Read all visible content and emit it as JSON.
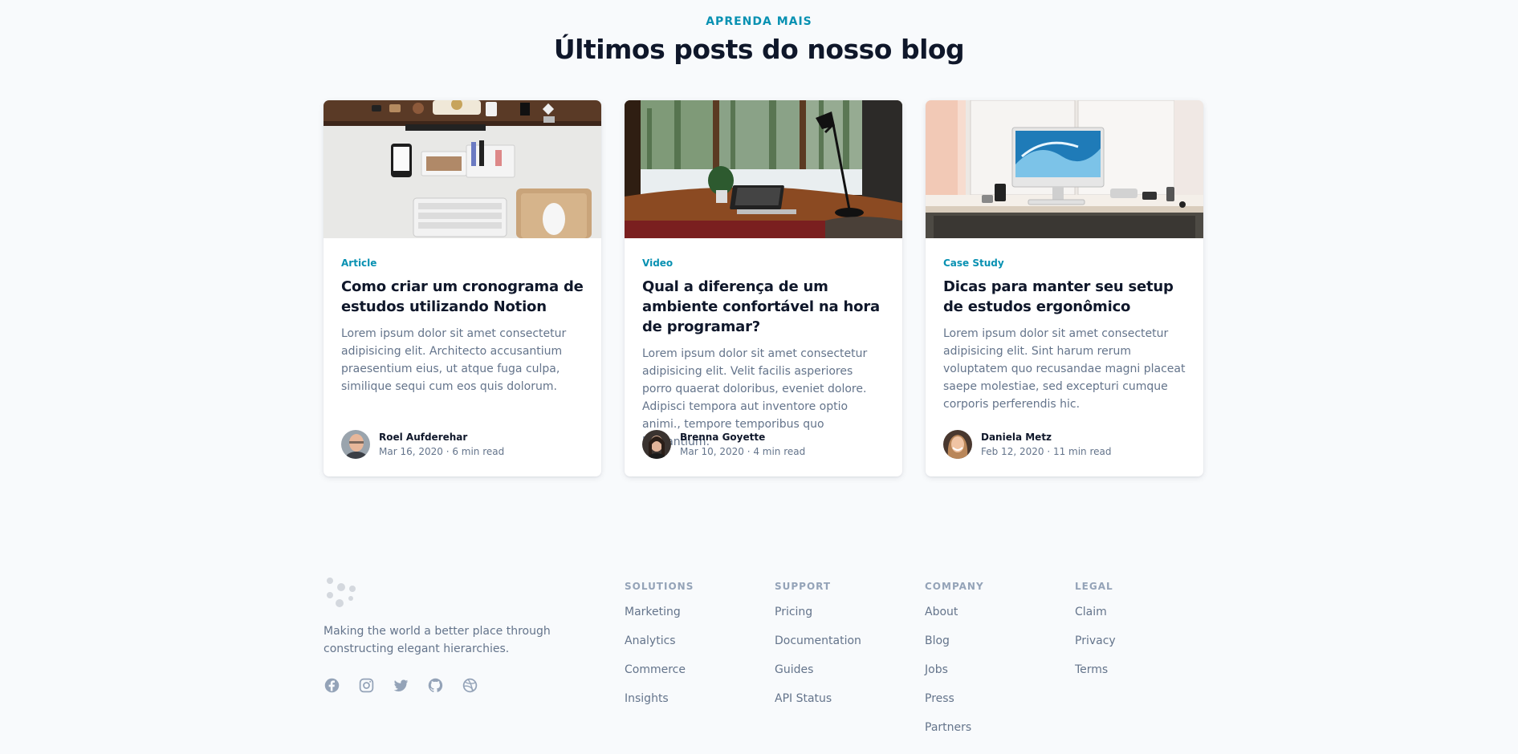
{
  "blog": {
    "eyebrow": "APRENDA MAIS",
    "title": "Últimos posts do nosso blog"
  },
  "posts": [
    {
      "category": "Article",
      "title": "Como criar um cronograma de estudos utilizando Notion",
      "excerpt": "Lorem ipsum dolor sit amet consectetur adipisicing elit. Architecto accusantium praesentium eius, ut atque fuga culpa, similique sequi cum eos quis dolorum.",
      "author": "Roel Aufderehar",
      "meta": "Mar 16, 2020 · 6 min read"
    },
    {
      "category": "Video",
      "title": "Qual a diferença de um ambiente confortável na hora de programar?",
      "excerpt": "Lorem ipsum dolor sit amet consectetur adipisicing elit. Velit facilis asperiores porro quaerat doloribus, eveniet dolore. Adipisci tempora aut inventore optio animi., tempore temporibus quo laudantium.",
      "author": "Brenna Goyette",
      "meta": "Mar 10, 2020 · 4 min read"
    },
    {
      "category": "Case Study",
      "title": "Dicas para manter seu setup de estudos ergonômico",
      "excerpt": "Lorem ipsum dolor sit amet consectetur adipisicing elit. Sint harum rerum voluptatem quo recusandae magni placeat saepe molestiae, sed excepturi cumque corporis perferendis hic.",
      "author": "Daniela Metz",
      "meta": "Feb 12, 2020 · 11 min read"
    }
  ],
  "footer": {
    "tagline": "Making the world a better place through constructing elegant hierarchies.",
    "social_icons": [
      "facebook-icon",
      "instagram-icon",
      "twitter-icon",
      "github-icon",
      "dribbble-icon"
    ],
    "columns": [
      {
        "title": "Solutions",
        "links": [
          "Marketing",
          "Analytics",
          "Commerce",
          "Insights"
        ]
      },
      {
        "title": "Support",
        "links": [
          "Pricing",
          "Documentation",
          "Guides",
          "API Status"
        ]
      },
      {
        "title": "Company",
        "links": [
          "About",
          "Blog",
          "Jobs",
          "Press",
          "Partners"
        ]
      },
      {
        "title": "Legal",
        "links": [
          "Claim",
          "Privacy",
          "Terms"
        ]
      }
    ]
  },
  "colors": {
    "accent": "#0891b2",
    "background": "#f8fafc",
    "heading": "#0f172a",
    "muted": "#64748b",
    "subtle": "#94a3b8"
  }
}
